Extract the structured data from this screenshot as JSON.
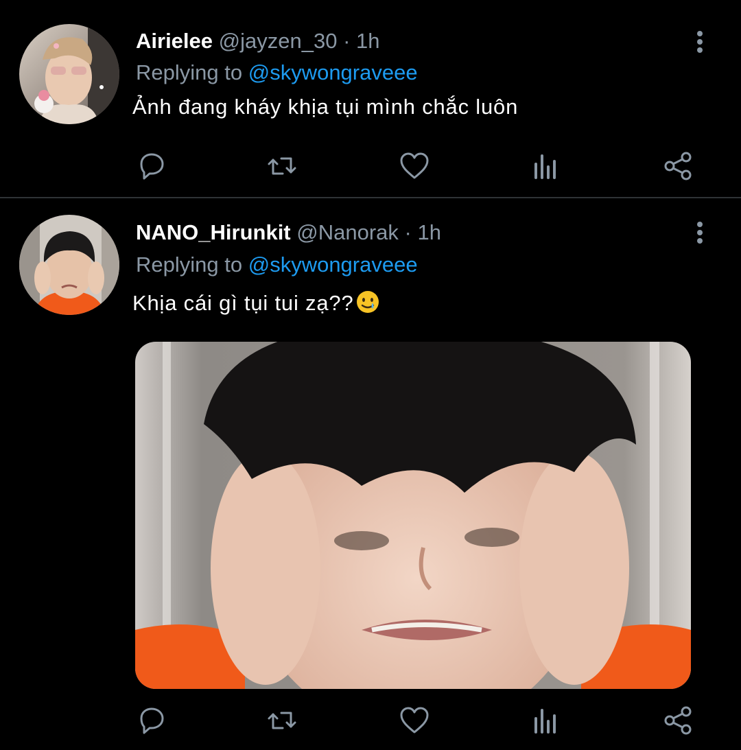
{
  "tweets": [
    {
      "name": "Airielee",
      "handle": "@jayzen_30",
      "dot": "·",
      "time": "1h",
      "reply_prefix": "Replying to",
      "reply_to": "@skywongraveee",
      "text": "Ảnh đang kháy khịa tụi mình chắc luôn"
    },
    {
      "name": "NANO_Hirunkit",
      "handle": "@Nanorak",
      "dot": "·",
      "time": "1h",
      "reply_prefix": "Replying to",
      "reply_to": "@skywongraveee",
      "text": "Khịa cái gì tụi tui zạ??",
      "emoji": "smiling-face-with-tear"
    }
  ],
  "actions": [
    "reply-icon",
    "retweet-icon",
    "like-icon",
    "views-icon",
    "share-icon"
  ],
  "colors": {
    "background": "#000000",
    "muted": "#8b98a5",
    "accent": "#1d9bf0",
    "divider": "#2f3336"
  }
}
